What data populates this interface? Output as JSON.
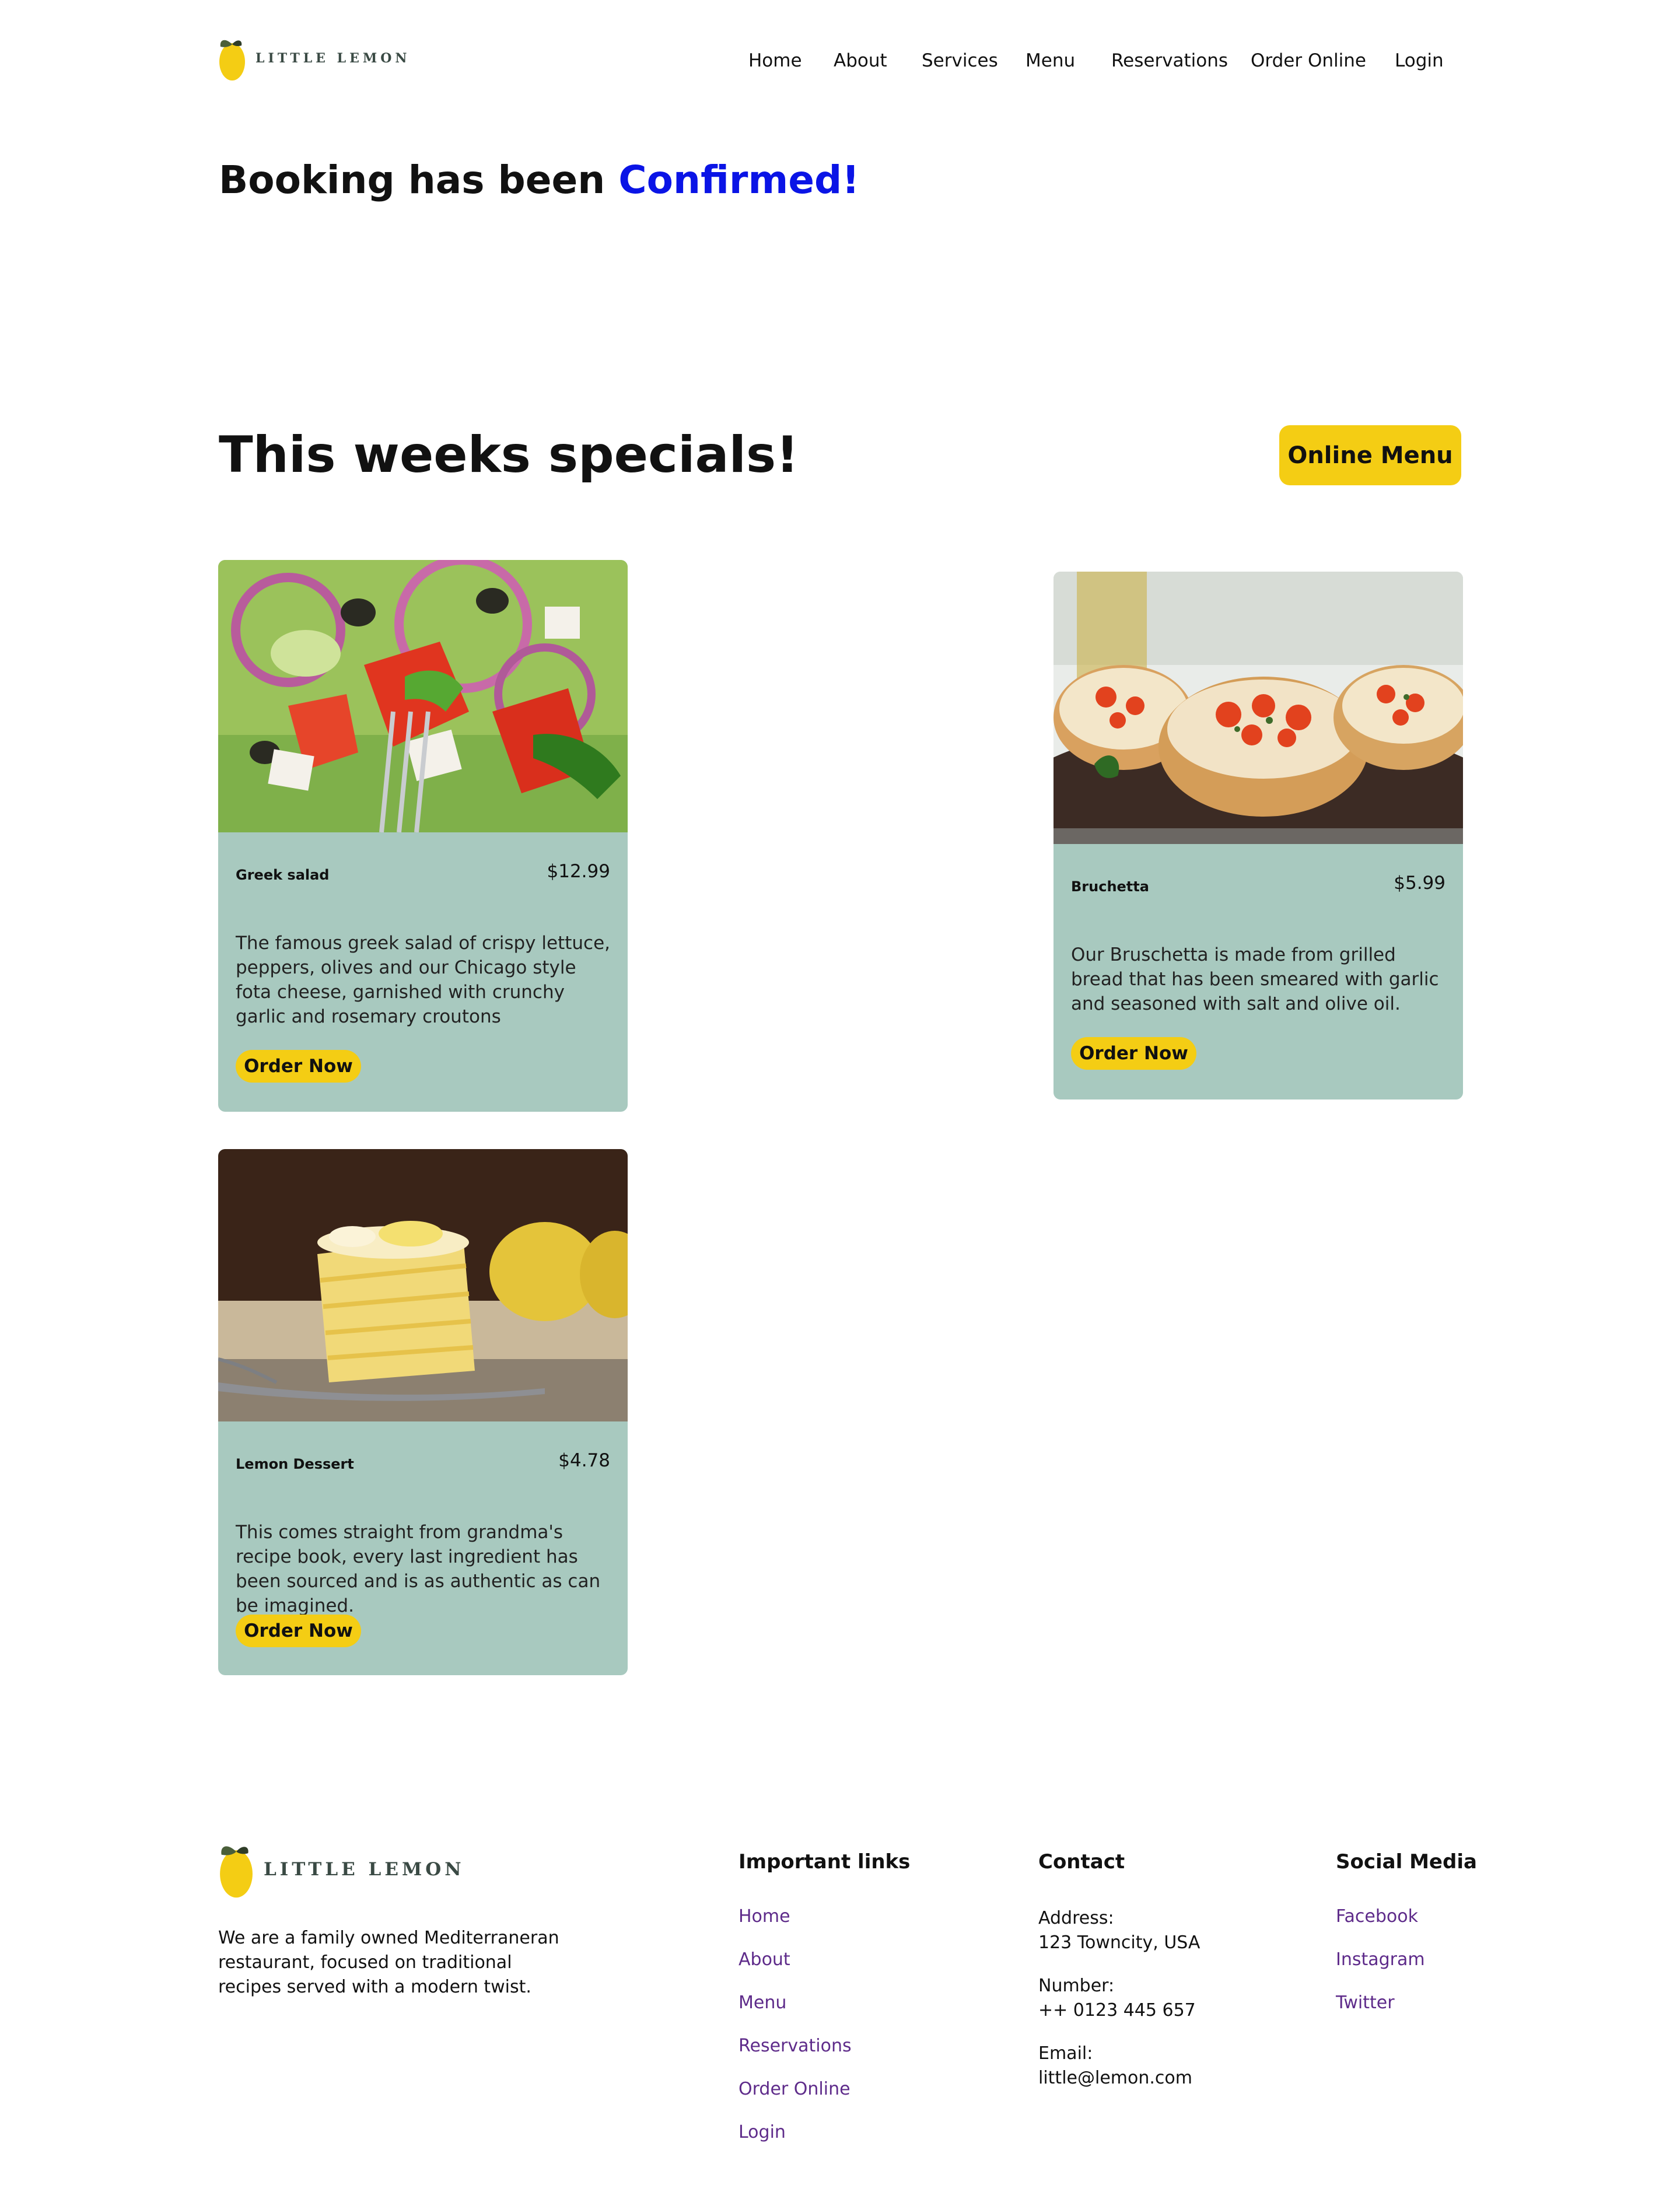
{
  "brand": {
    "name": "LITTLE LEMON",
    "accent_color": "#f4cd14",
    "card_color": "#a8c9bf",
    "link_color": "#5e2b8a",
    "confirm_color": "#0a14e6"
  },
  "nav": {
    "items": [
      "Home",
      "About",
      "Services",
      "Menu",
      "Reservations",
      "Order Online",
      "Login"
    ]
  },
  "booking": {
    "prefix": "Booking has been",
    "highlight": "Confirmed!"
  },
  "specials": {
    "title": "This weeks specials!",
    "menu_button": "Online Menu",
    "cards": [
      {
        "name": "Greek salad",
        "price": "$12.99",
        "description": "The famous greek salad of crispy lettuce, peppers, olives and our Chicago style fota cheese, garnished with crunchy garlic and rosemary croutons",
        "button": "Order Now",
        "image_icon": "greek-salad-image"
      },
      {
        "name": "Bruchetta",
        "price": "$5.99",
        "description": "Our Bruschetta is made from grilled bread that has been smeared with garlic and seasoned with salt and olive oil.",
        "button": "Order Now",
        "image_icon": "bruschetta-image"
      },
      {
        "name": "Lemon Dessert",
        "price": "$4.78",
        "description": "This comes straight from grandma's recipe book, every last ingredient has been sourced and is as authentic as can be imagined.",
        "button": "Order Now",
        "image_icon": "lemon-dessert-image"
      }
    ]
  },
  "footer": {
    "about": "We are a family owned Mediterraneran restaurant, focused on traditional recipes served with a modern twist.",
    "links_title": "Important links",
    "links": [
      "Home",
      "About",
      "Menu",
      "Reservations",
      "Order Online",
      "Login"
    ],
    "contact_title": "Contact",
    "contact": {
      "address_label": "Address:",
      "address": "123 Towncity, USA",
      "number_label": "Number:",
      "number": "++ 0123 445 657",
      "email_label": "Email:",
      "email": "little@lemon.com"
    },
    "social_title": "Social Media",
    "social": [
      "Facebook",
      "Instagram",
      "Twitter"
    ]
  }
}
